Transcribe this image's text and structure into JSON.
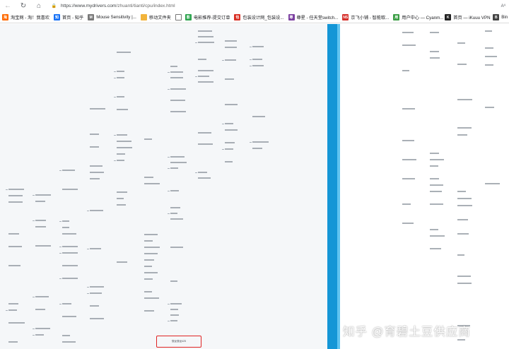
{
  "browser": {
    "url_host": "https://www.mydrivers.com",
    "url_path": "/zhuanti/tianti/cpu/index.html",
    "reader_label": "Aᴬ",
    "bookmarks": [
      {
        "label": "淘宝网 - 淘！我喜欢",
        "icon": "taobao-icon",
        "color": "#ff6a00",
        "glyph": "淘",
        "w": 76
      },
      {
        "label": "首页 - 知乎",
        "icon": "zhihu-icon",
        "color": "#1772f6",
        "glyph": "知",
        "w": 60
      },
      {
        "label": "Mouse Sensitivity |...",
        "icon": "mouse-sensitivity-icon",
        "color": "#7a7a7a",
        "glyph": "M",
        "w": 88
      },
      {
        "label": "移动文件夹",
        "icon": "folder-icon",
        "color": "#f2b43c",
        "glyph": "",
        "w": 50
      },
      {
        "label": "",
        "icon": "document-icon",
        "color": "#ffffff",
        "glyph": "",
        "w": 14
      },
      {
        "label": "电影推荐-提交订单",
        "icon": "movie-icon",
        "color": "#2da44e",
        "glyph": "影",
        "w": 70
      },
      {
        "label": "包装设计网_包装设...",
        "icon": "design-icon",
        "color": "#d93025",
        "glyph": "包",
        "w": 80
      },
      {
        "label": "尊星 - 任天堂switch...",
        "icon": "nintendo-icon",
        "color": "#7b3fa0",
        "glyph": "尊",
        "w": 83
      },
      {
        "label": "京飞小铺 - 智能取...",
        "icon": "shop-icon",
        "color": "#d6302b",
        "glyph": "NS",
        "w": 72
      },
      {
        "label": "用户中心 — Cyanm...",
        "icon": "user-center-icon",
        "color": "#3a9d44",
        "glyph": "用",
        "w": 73
      },
      {
        "label": "首页 — iKuuu VPN",
        "icon": "vpn-icon",
        "color": "#222222",
        "glyph": "K",
        "w": 68
      },
      {
        "label": "Bin",
        "icon": "bing-icon",
        "color": "#444444",
        "glyph": "B",
        "w": 30
      }
    ]
  },
  "content": {
    "highlight_label": "骁龙骁龙425",
    "watermark": "知乎 @育碧土豆供应商"
  },
  "colors": {
    "stripe_dark": "#1496d6",
    "stripe_light": "#5fc4f0",
    "highlight": "#e02424"
  }
}
